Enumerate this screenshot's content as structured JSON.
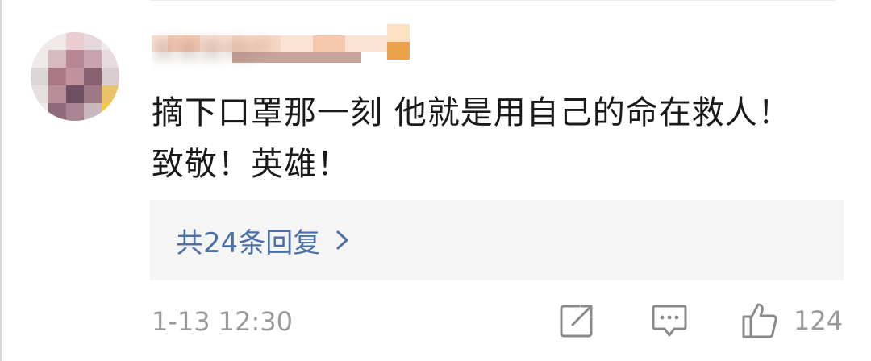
{
  "comment": {
    "username": "某某某用户",
    "text": "摘下口罩那一刻 他就是用自己的命在救人！致敬！英雄！",
    "replies_label": "共24条回复",
    "timestamp": "1-13 12:30",
    "like_count": "124"
  },
  "icons": {
    "share": "share-icon",
    "reply": "comment-icon",
    "like": "thumbs-up-icon",
    "chevron": "chevron-right-icon"
  },
  "colors": {
    "link": "#4a6fa5",
    "muted": "#9a9a9a",
    "text": "#1a1a1a",
    "replies_bg": "#f5f5f5"
  }
}
